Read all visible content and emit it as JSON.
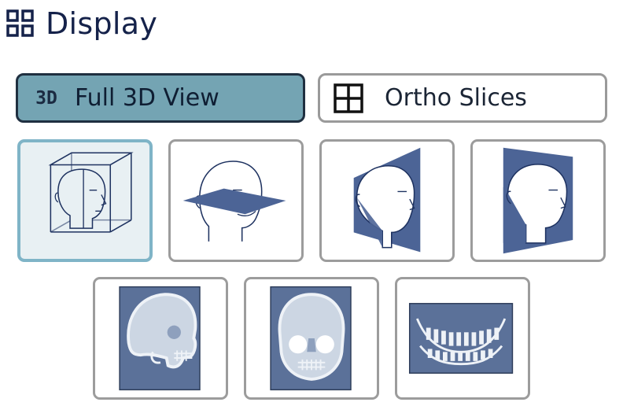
{
  "header": {
    "title": "Display",
    "icon": "grid-icon"
  },
  "modes": [
    {
      "label": "Full 3D View",
      "icon_text": "3D",
      "icon": "3d-icon",
      "selected": true
    },
    {
      "label": "Ortho Slices",
      "icon": "quad-grid-icon",
      "selected": false
    }
  ],
  "views": [
    {
      "name": "volume-cube-view",
      "icon": "head-in-cube-icon",
      "selected": true
    },
    {
      "name": "axial-slice-view",
      "icon": "head-axial-plane-icon",
      "selected": false
    },
    {
      "name": "sagittal-slice-view",
      "icon": "head-sagittal-plane-icon",
      "selected": false
    },
    {
      "name": "coronal-slice-view",
      "icon": "head-coronal-plane-icon",
      "selected": false
    },
    {
      "name": "lateral-xray-view",
      "icon": "lateral-skull-xray-icon",
      "selected": false
    },
    {
      "name": "frontal-xray-view",
      "icon": "frontal-skull-xray-icon",
      "selected": false
    },
    {
      "name": "panoramic-xray-view",
      "icon": "panoramic-dental-xray-icon",
      "selected": false
    }
  ],
  "colors": {
    "title": "#15224a",
    "selected_button_bg": "#74a4b3",
    "selected_tile_bg": "#e8f0f3",
    "selected_tile_border": "#7fb4c7",
    "tile_border": "#9c9c9c",
    "plane": "#4c6496",
    "xray_bg": "#5b7199"
  }
}
